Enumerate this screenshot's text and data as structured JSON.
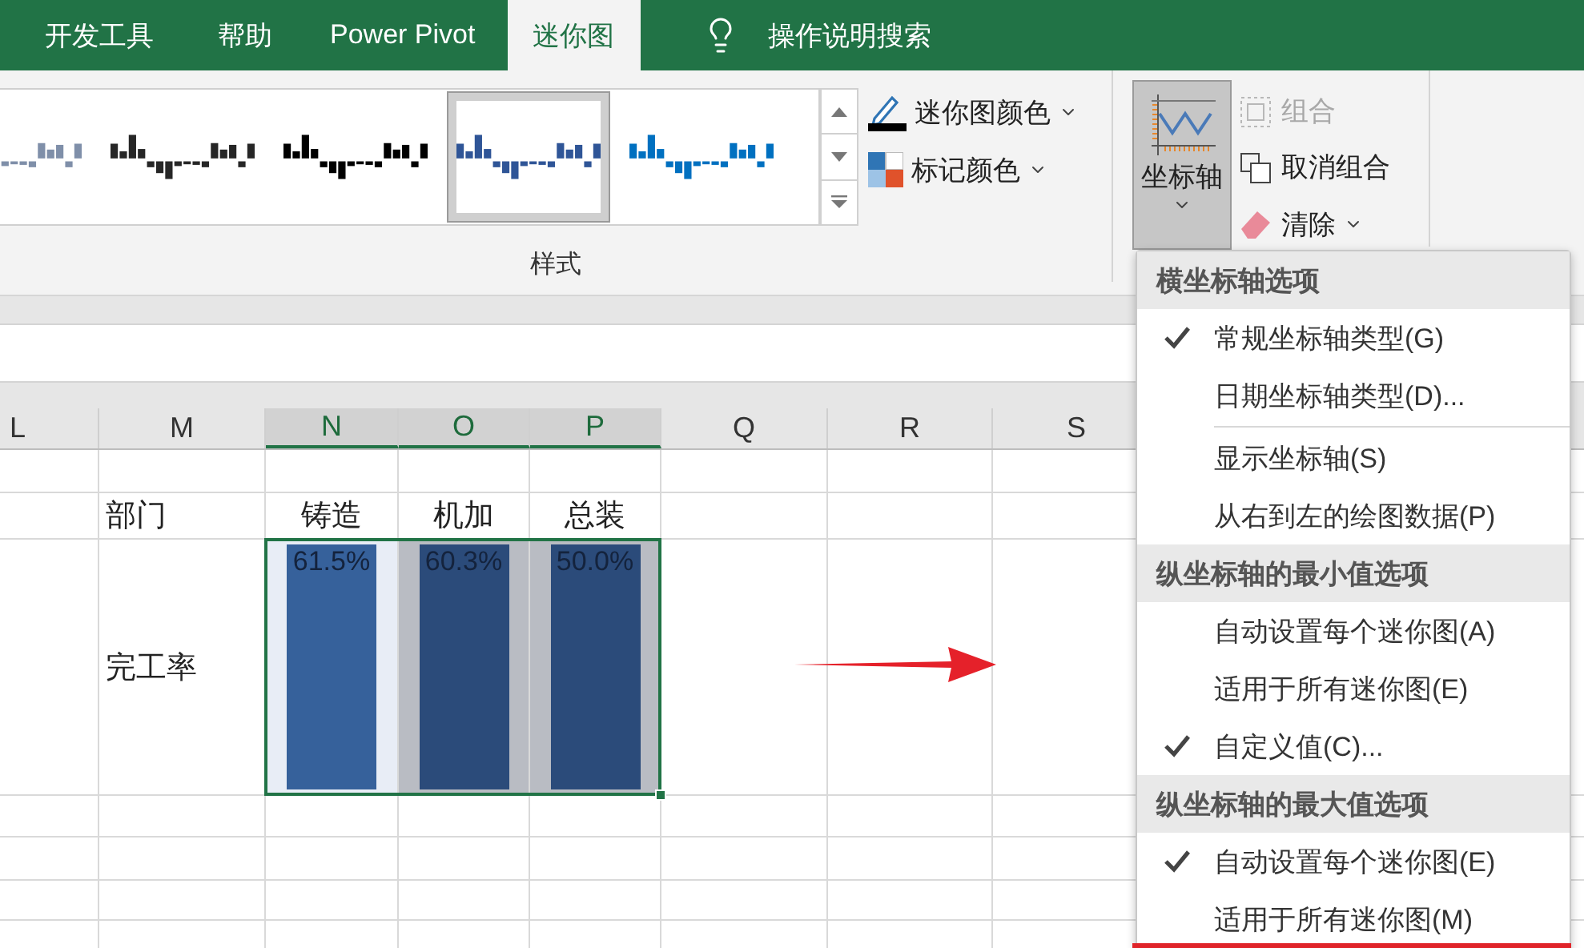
{
  "tabs": [
    {
      "label": "开发工具",
      "selected": false
    },
    {
      "label": "帮助",
      "selected": false
    },
    {
      "label": "Power Pivot",
      "selected": false
    },
    {
      "label": "迷你图",
      "selected": true
    }
  ],
  "search": {
    "label": "操作说明搜索"
  },
  "ribbon": {
    "gallery": {
      "styles": [
        {
          "color": "#7f8fa9",
          "selected": false
        },
        {
          "color": "#262626",
          "selected": false
        },
        {
          "color": "#000000",
          "selected": false
        },
        {
          "color": "#2f5597",
          "selected": true
        },
        {
          "color": "#0070c0",
          "selected": false
        }
      ]
    },
    "color_buttons": [
      {
        "label": "迷你图颜色",
        "kind": "pen"
      },
      {
        "label": "标记颜色",
        "kind": "marker"
      }
    ],
    "group_label": "样式",
    "axis_button": {
      "label": "坐标轴",
      "pressed": true
    },
    "group_buttons": [
      {
        "label": "组合",
        "kind": "group",
        "disabled": true,
        "dropdown": false
      },
      {
        "label": "取消组合",
        "kind": "ungroup",
        "disabled": false,
        "dropdown": false
      },
      {
        "label": "清除",
        "kind": "clear",
        "disabled": false,
        "dropdown": true
      }
    ]
  },
  "sheet": {
    "columns": [
      {
        "label": "L",
        "selected": false
      },
      {
        "label": "M",
        "selected": false
      },
      {
        "label": "N",
        "selected": true
      },
      {
        "label": "O",
        "selected": true
      },
      {
        "label": "P",
        "selected": true
      },
      {
        "label": "Q",
        "selected": false
      },
      {
        "label": "R",
        "selected": false
      },
      {
        "label": "S",
        "selected": false
      }
    ],
    "rows": [
      {
        "cells": [
          null,
          null,
          null,
          null,
          null,
          null,
          null,
          null
        ]
      },
      {
        "cells": [
          null,
          {
            "kind": "label",
            "text": "部门"
          },
          {
            "kind": "text",
            "text": "铸造"
          },
          {
            "kind": "text",
            "text": "机加"
          },
          {
            "kind": "text",
            "text": "总装"
          },
          null,
          null,
          null
        ]
      },
      {
        "cells": [
          null,
          {
            "kind": "label",
            "text": "完工率"
          },
          {
            "kind": "sparkline",
            "value": "61.5%",
            "selected": true,
            "active": true
          },
          {
            "kind": "sparkline",
            "value": "60.3%",
            "selected": true,
            "active": false
          },
          {
            "kind": "sparkline",
            "value": "50.0%",
            "selected": true,
            "active": false
          },
          null,
          null,
          null
        ]
      },
      {
        "cells": [
          null,
          null,
          null,
          null,
          null,
          null,
          null,
          null
        ]
      },
      {
        "cells": [
          null,
          null,
          null,
          null,
          null,
          null,
          null,
          null
        ]
      },
      {
        "cells": [
          null,
          null,
          null,
          null,
          null,
          null,
          null,
          null
        ]
      },
      {
        "cells": [
          null,
          null,
          null,
          null,
          null,
          null,
          null,
          null
        ]
      }
    ]
  },
  "axis_menu": {
    "sections": [
      {
        "title": "横坐标轴选项",
        "items": [
          {
            "label": "常规坐标轴类型(G)",
            "checked": true,
            "separator_after": false
          },
          {
            "label": "日期坐标轴类型(D)...",
            "checked": false,
            "separator_after": true
          },
          {
            "label": "显示坐标轴(S)",
            "checked": false,
            "separator_after": false
          },
          {
            "label": "从右到左的绘图数据(P)",
            "checked": false,
            "separator_after": false
          }
        ]
      },
      {
        "title": "纵坐标轴的最小值选项",
        "items": [
          {
            "label": "自动设置每个迷你图(A)",
            "checked": false,
            "separator_after": false
          },
          {
            "label": "适用于所有迷你图(E)",
            "checked": false,
            "separator_after": false
          },
          {
            "label": "自定义值(C)...",
            "checked": true,
            "separator_after": false
          }
        ]
      },
      {
        "title": "纵坐标轴的最大值选项",
        "items": [
          {
            "label": "自动设置每个迷你图(E)",
            "checked": true,
            "separator_after": false
          },
          {
            "label": "适用于所有迷你图(M)",
            "checked": false,
            "separator_after": false
          }
        ]
      }
    ]
  }
}
